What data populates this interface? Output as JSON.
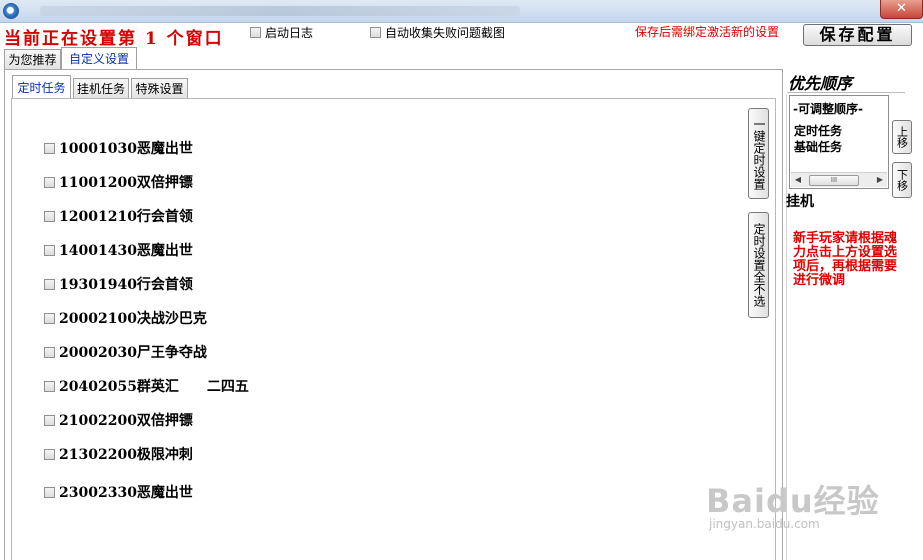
{
  "window": {
    "close_label": "✕"
  },
  "header": {
    "banner_text": "当前正在设置第 1 个窗口",
    "checkboxes": [
      {
        "label": "启动日志",
        "checked": false
      },
      {
        "label": "自动收集失败问题截图",
        "checked": false
      }
    ],
    "notice": "保存后需绑定激活新的设置",
    "save_button": "保存配置"
  },
  "outer_tabs": [
    {
      "label": "为您推荐",
      "active": false
    },
    {
      "label": "自定义设置",
      "active": true
    }
  ],
  "inner_tabs": [
    {
      "label": "定时任务",
      "active": true
    },
    {
      "label": "挂机任务",
      "active": false
    },
    {
      "label": "特殊设置",
      "active": false
    }
  ],
  "tasks": [
    {
      "label": "10001030恶魔出世",
      "checked": false
    },
    {
      "label": "11001200双倍押镖",
      "checked": false
    },
    {
      "label": "12001210行会首领",
      "checked": false
    },
    {
      "label": "14001430恶魔出世",
      "checked": false
    },
    {
      "label": "19301940行会首领",
      "checked": false
    },
    {
      "label": "20002100决战沙巴克",
      "checked": false
    },
    {
      "label": "20002030尸王争夺战",
      "checked": false
    },
    {
      "label": "20402055群英汇　　二四五",
      "checked": false
    },
    {
      "label": "21002200双倍押镖",
      "checked": false
    },
    {
      "label": "21302200极限冲刺",
      "checked": false
    },
    {
      "label": "23002330恶魔出世",
      "checked": false
    }
  ],
  "side_buttons": {
    "one_key": "一键定时设置",
    "deselect_all": "定时设置全不选"
  },
  "priority": {
    "title": "优先顺序",
    "list_header": "-可调整顺序-",
    "items": [
      "定时任务",
      "基础任务"
    ],
    "scroll_thumb": "III",
    "up": "上移",
    "down": "下移"
  },
  "idle_label": "挂机",
  "tip": "新手玩家请根据魂力点击上方设置选项后，再根据需要进行微调",
  "watermark": {
    "logo": "Baidu经验",
    "url": "jingyan.baidu.com"
  }
}
